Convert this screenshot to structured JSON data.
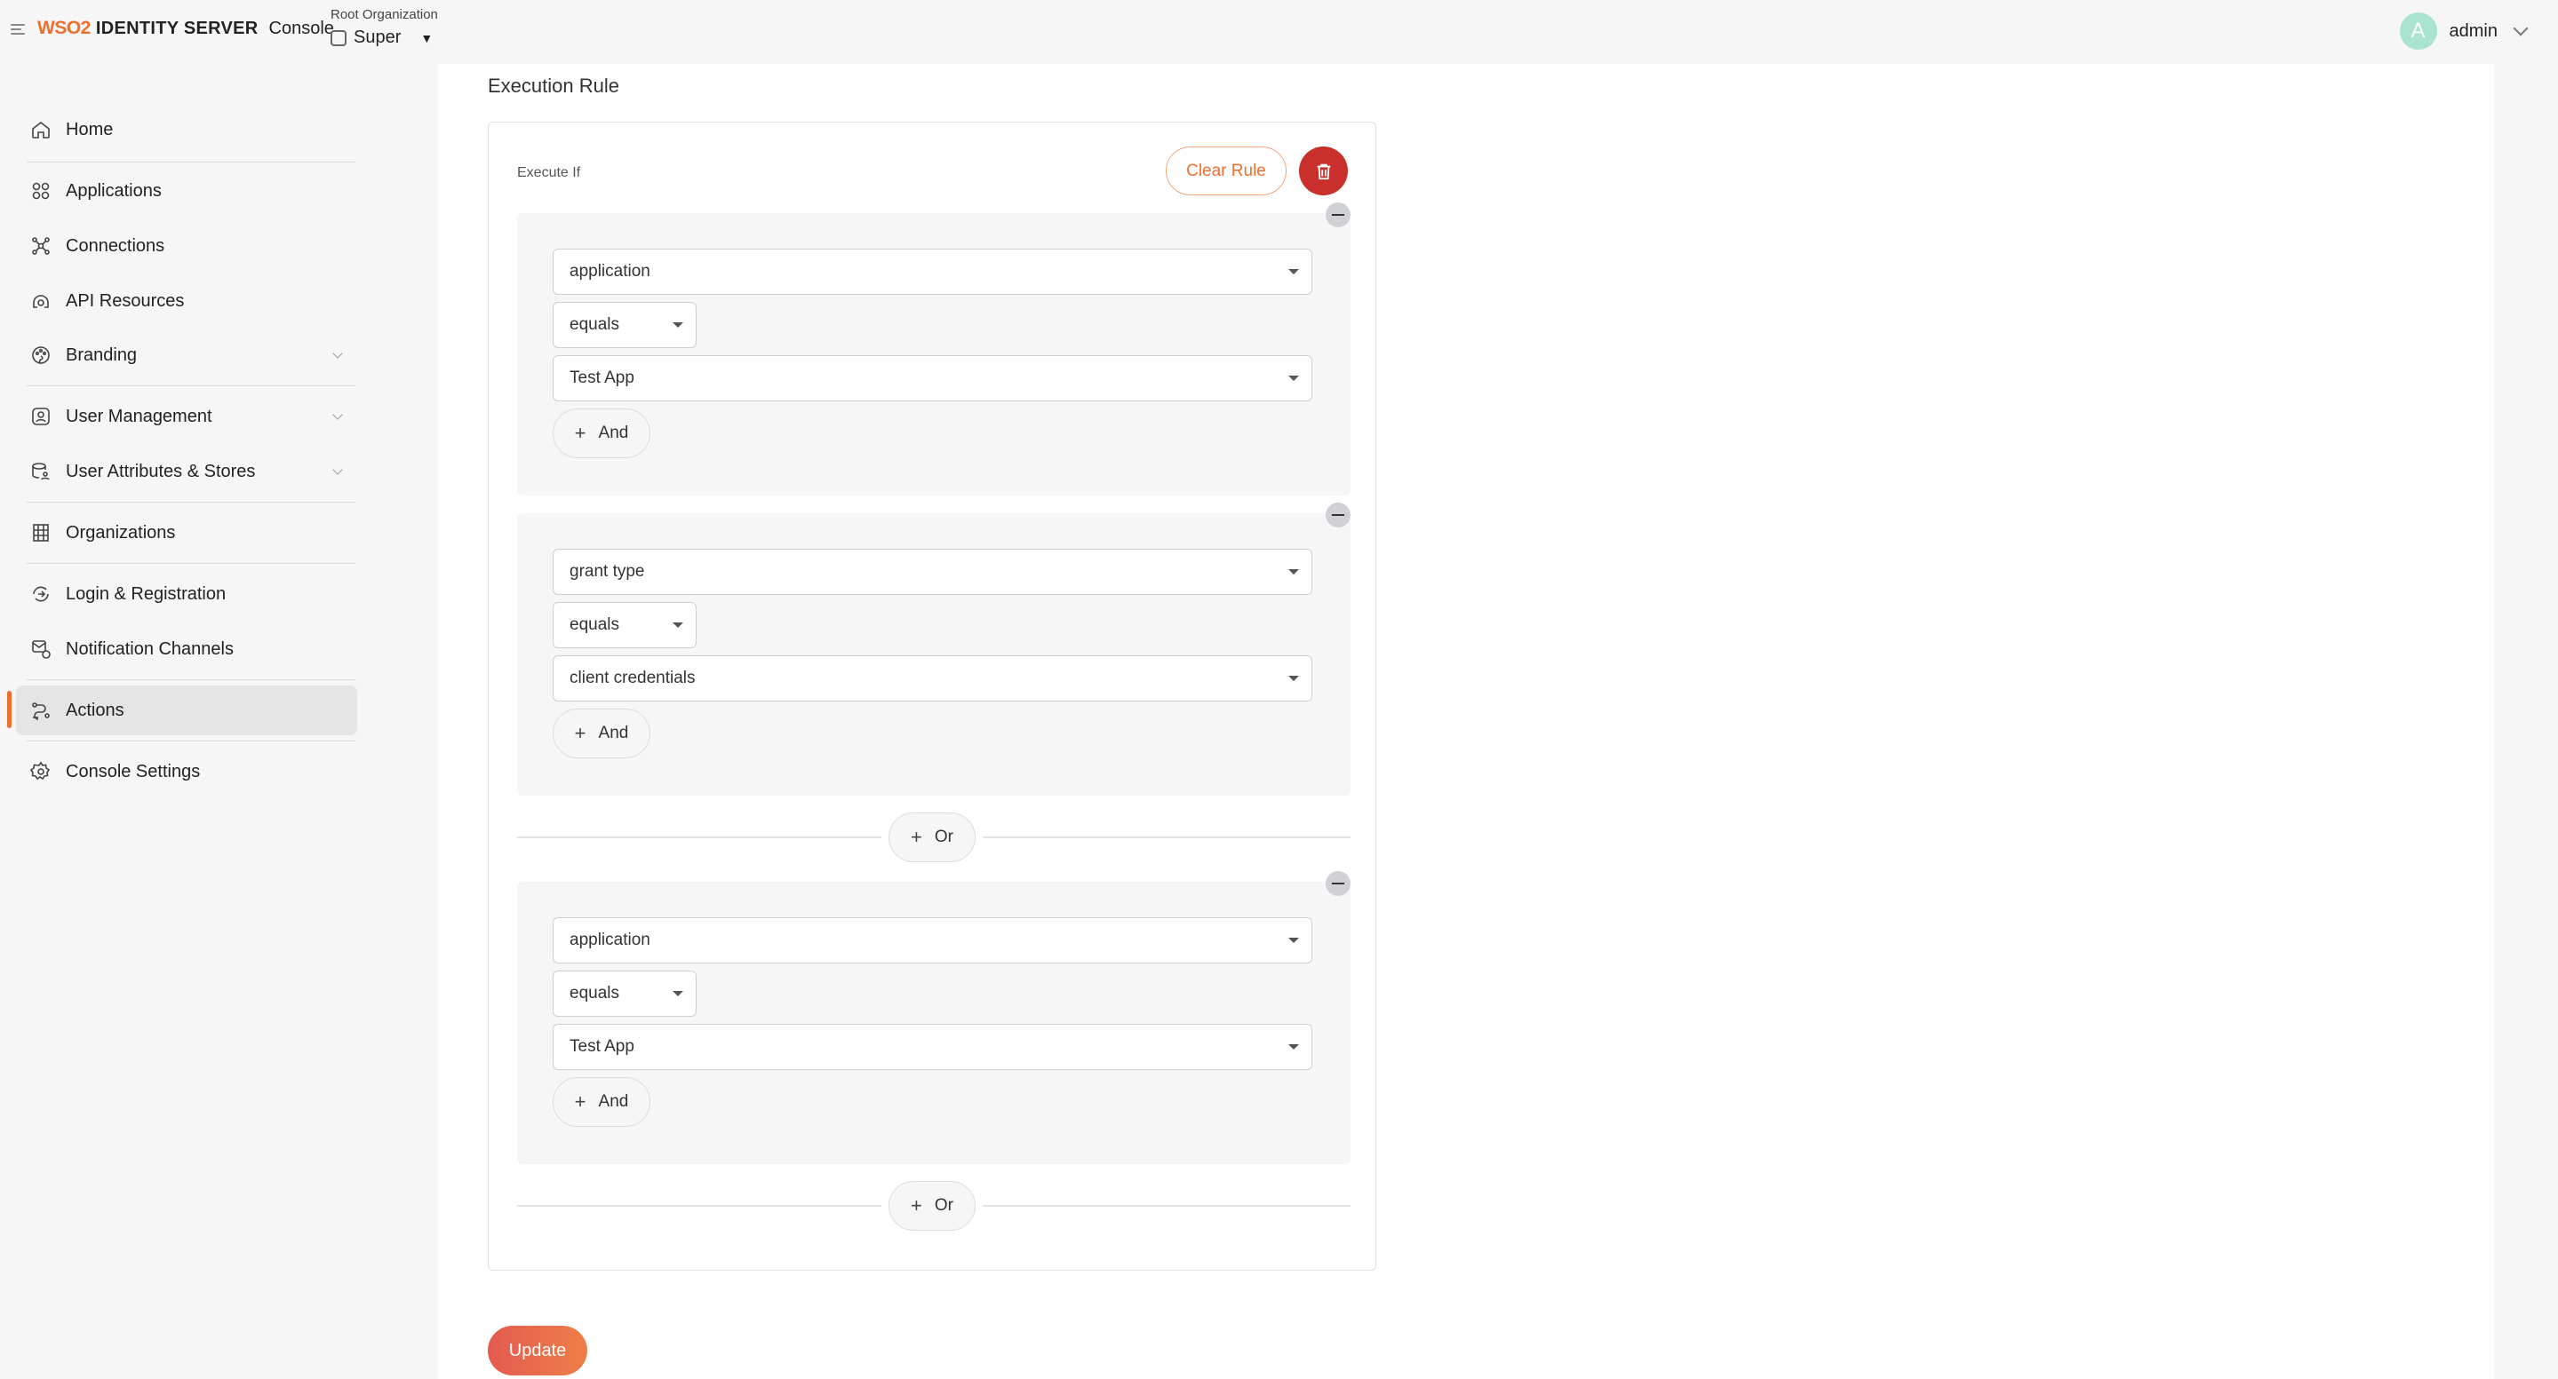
{
  "header": {
    "logo_brand": "WSO2",
    "logo_product": "IDENTITY SERVER",
    "logo_console": "Console",
    "org_label": "Root Organization",
    "org_name": "Super",
    "user_initial": "A",
    "user_name": "admin"
  },
  "sidebar": {
    "items": [
      {
        "label": "Home",
        "icon": "home-icon"
      },
      {
        "label": "Applications",
        "icon": "applications-icon"
      },
      {
        "label": "Connections",
        "icon": "connections-icon"
      },
      {
        "label": "API Resources",
        "icon": "api-resources-icon"
      },
      {
        "label": "Branding",
        "icon": "branding-icon",
        "expandable": true
      },
      {
        "label": "User Management",
        "icon": "user-management-icon",
        "expandable": true
      },
      {
        "label": "User Attributes & Stores",
        "icon": "user-attributes-icon",
        "expandable": true
      },
      {
        "label": "Organizations",
        "icon": "organizations-icon"
      },
      {
        "label": "Login & Registration",
        "icon": "login-registration-icon"
      },
      {
        "label": "Notification Channels",
        "icon": "notification-channels-icon"
      },
      {
        "label": "Actions",
        "icon": "actions-icon",
        "active": true
      },
      {
        "label": "Console Settings",
        "icon": "console-settings-icon"
      }
    ]
  },
  "main": {
    "section_title": "Execution Rule",
    "execute_if_label": "Execute If",
    "clear_rule_label": "Clear Rule",
    "groups": [
      {
        "field": "application",
        "operator": "equals",
        "value": "Test App",
        "and_label": "And"
      },
      {
        "field": "grant type",
        "operator": "equals",
        "value": "client credentials",
        "and_label": "And"
      },
      {
        "field": "application",
        "operator": "equals",
        "value": "Test App",
        "and_label": "And"
      }
    ],
    "or_label": "Or",
    "update_label": "Update"
  },
  "colors": {
    "accent": "#ee6f2d",
    "delete": "#c9302c",
    "avatar": "#a8e4cf"
  }
}
